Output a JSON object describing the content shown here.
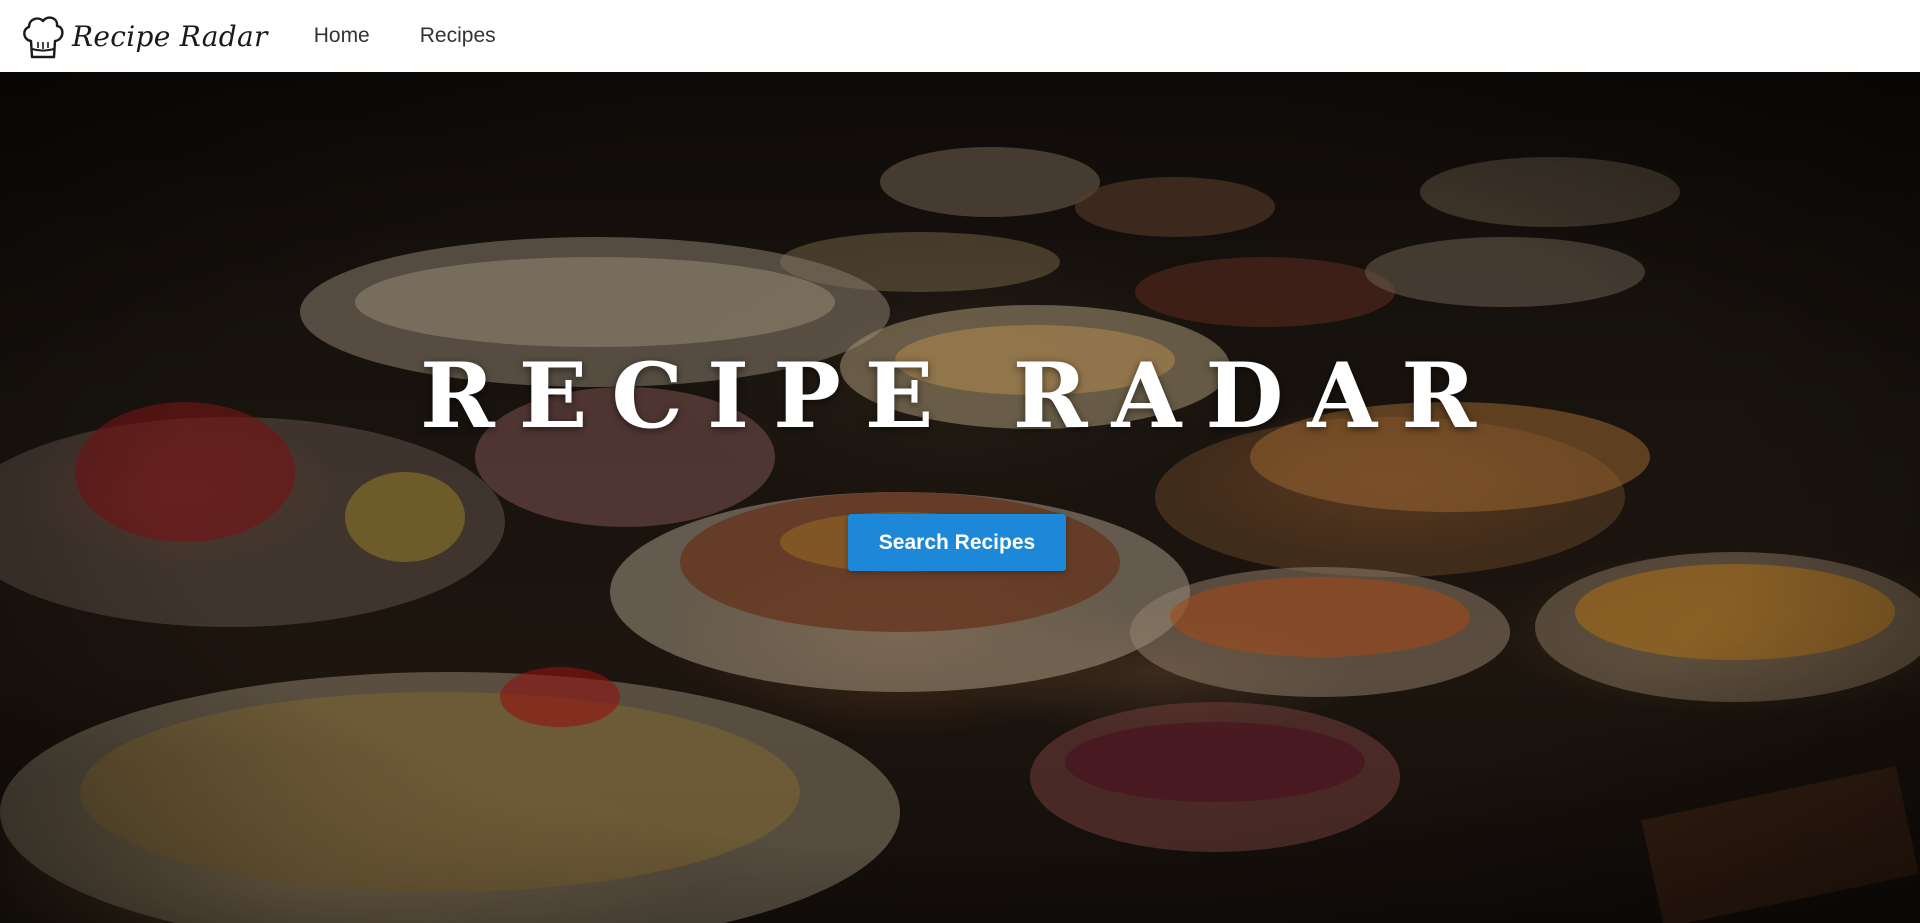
{
  "brand": {
    "name": "Recipe Radar",
    "logo_icon": "chef-hat-icon"
  },
  "nav": {
    "items": [
      {
        "label": "Home"
      },
      {
        "label": "Recipes"
      }
    ]
  },
  "hero": {
    "title": "RECIPE RADAR",
    "button_label": "Search Recipes",
    "background": "food-table-photo"
  },
  "colors": {
    "navbar_bg": "#ffffff",
    "accent": "#1e88d8",
    "hero_text": "#ffffff"
  }
}
